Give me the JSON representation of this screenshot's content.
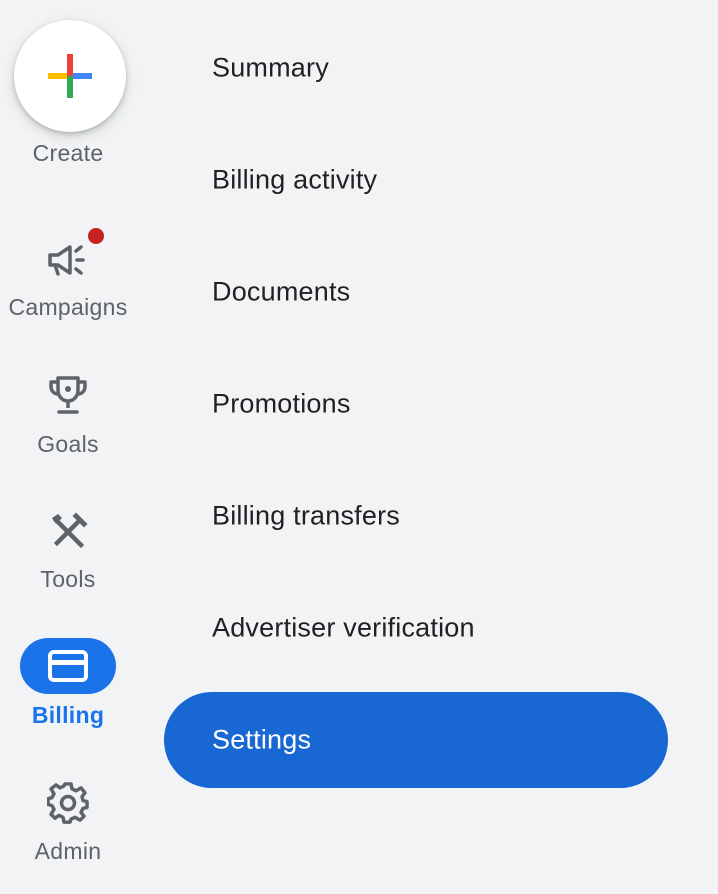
{
  "rail": {
    "create_label": "Create",
    "items": [
      {
        "label": "Campaigns",
        "icon": "megaphone-icon",
        "has_notification": true
      },
      {
        "label": "Goals",
        "icon": "trophy-icon"
      },
      {
        "label": "Tools",
        "icon": "tools-icon"
      },
      {
        "label": "Billing",
        "icon": "credit-card-icon",
        "active": true
      },
      {
        "label": "Admin",
        "icon": "gear-icon"
      }
    ]
  },
  "submenu": {
    "items": [
      {
        "label": "Summary"
      },
      {
        "label": "Billing activity"
      },
      {
        "label": "Documents"
      },
      {
        "label": "Promotions"
      },
      {
        "label": "Billing transfers"
      },
      {
        "label": "Advertiser verification"
      },
      {
        "label": "Settings",
        "selected": true
      }
    ]
  },
  "colors": {
    "background": "#f1f3f4",
    "accent": "#1a73e8",
    "selected": "#1967d2",
    "notification": "#c5221f",
    "icon": "#5f6368",
    "text": "#202124"
  }
}
